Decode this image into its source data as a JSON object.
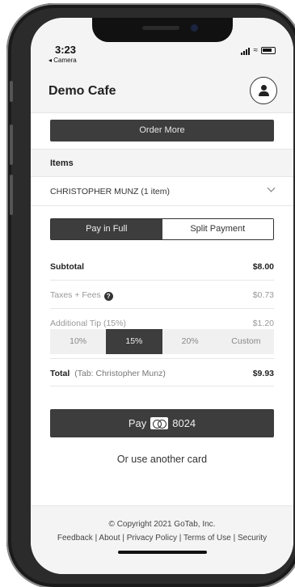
{
  "status": {
    "time": "3:23",
    "back_app": "◂ Camera"
  },
  "header": {
    "title": "Demo Cafe",
    "account_icon": "user-icon"
  },
  "actions": {
    "order_more": "Order More"
  },
  "items": {
    "heading": "Items",
    "guest_label": "CHRISTOPHER MUNZ (1 item)"
  },
  "payment": {
    "tabs": [
      {
        "label": "Pay in Full",
        "active": true
      },
      {
        "label": "Split Payment",
        "active": false
      }
    ],
    "subtotal_label": "Subtotal",
    "subtotal_value": "$8.00",
    "taxes_label": "Taxes + Fees",
    "taxes_value": "$0.73",
    "tip_label": "Additional Tip (15%)",
    "tip_value": "$1.20",
    "tip_options": [
      "10%",
      "15%",
      "20%",
      "Custom"
    ],
    "tip_selected": "15%",
    "total_label": "Total",
    "total_tab": "(Tab: Christopher Munz)",
    "total_value": "$9.93",
    "pay_prefix": "Pay",
    "card_last4": "8024",
    "other_card": "Or use another card"
  },
  "footer": {
    "copyright": "© Copyright 2021 GoTab, Inc.",
    "links": [
      "Feedback",
      "About",
      "Privacy Policy",
      "Terms of Use",
      "Security"
    ]
  }
}
